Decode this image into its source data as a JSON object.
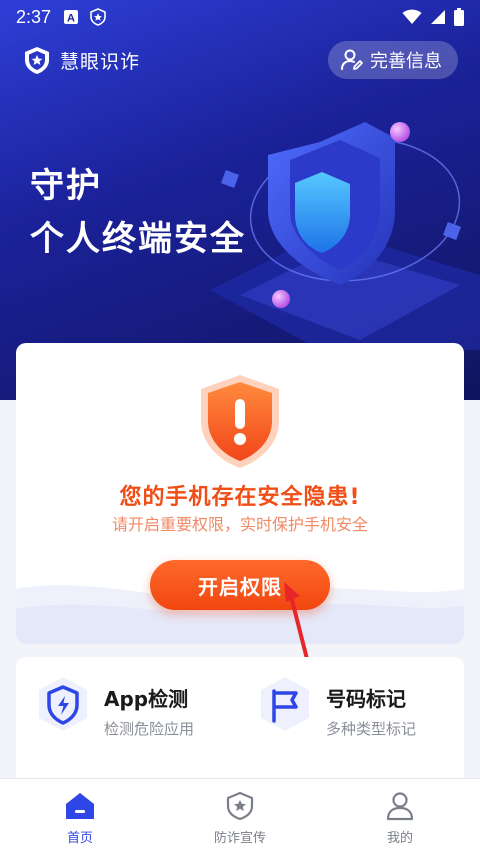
{
  "status_bar": {
    "time": "2:37"
  },
  "app": {
    "name": "慧眼识诈",
    "complete_info_label": "完善信息"
  },
  "hero": {
    "line1": "守护",
    "line2": "个人终端安全"
  },
  "alert": {
    "title": "您的手机存在安全隐患!",
    "subtitle": "请开启重要权限，实时保护手机安全",
    "button_label": "开启权限"
  },
  "tools": [
    {
      "title": "App检测",
      "subtitle": "检测危险应用",
      "icon": "lightning-shield-icon"
    },
    {
      "title": "号码标记",
      "subtitle": "多种类型标记",
      "icon": "flag-icon"
    }
  ],
  "nav": {
    "items": [
      {
        "label": "首页",
        "icon": "home-icon",
        "active": true
      },
      {
        "label": "防诈宣传",
        "icon": "star-shield-icon",
        "active": false
      },
      {
        "label": "我的",
        "icon": "user-icon",
        "active": false
      }
    ]
  },
  "colors": {
    "brand_blue": "#2f46e6",
    "alert_orange": "#f04e16",
    "hero_dark": "#10145e"
  }
}
